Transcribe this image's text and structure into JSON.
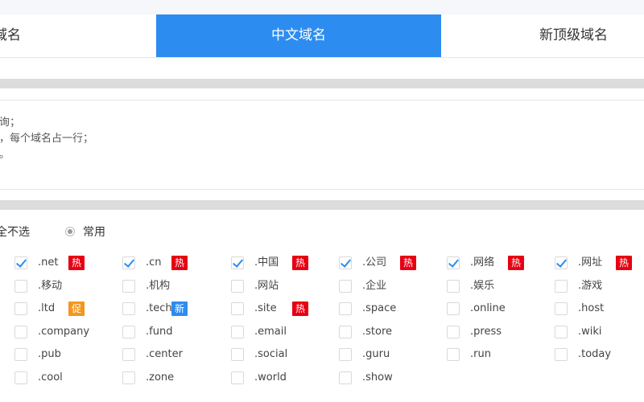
{
  "tabs": [
    {
      "label": "文域名"
    },
    {
      "label": "中文域名"
    },
    {
      "label": "新顶级域名"
    }
  ],
  "hints": [
    "查询；",
    "隔，每个域名占一行；",
    "缀。"
  ],
  "options": {
    "select_none": "全不选",
    "common": "常用"
  },
  "badges": {
    "hot": "热",
    "promo": "促",
    "new": "新"
  },
  "colors": {
    "accent": "#2d8cf0",
    "hot": "#e60012",
    "promo": "#f5961e",
    "new": "#2d8cf0"
  },
  "domains": [
    [
      {
        "label": ".net",
        "checked": true,
        "badge": "hot"
      },
      {
        "label": ".cn",
        "checked": true,
        "badge": "hot"
      },
      {
        "label": ".中国",
        "checked": true,
        "badge": "hot"
      },
      {
        "label": ".公司",
        "checked": true,
        "badge": "hot"
      },
      {
        "label": ".网络",
        "checked": true,
        "badge": "hot"
      },
      {
        "label": ".网址",
        "checked": true,
        "badge": "hot"
      }
    ],
    [
      {
        "label": ".移动",
        "checked": false,
        "badge": null
      },
      {
        "label": ".机构",
        "checked": false,
        "badge": null
      },
      {
        "label": ".网站",
        "checked": false,
        "badge": null
      },
      {
        "label": ".企业",
        "checked": false,
        "badge": null
      },
      {
        "label": ".娱乐",
        "checked": false,
        "badge": null
      },
      {
        "label": ".游戏",
        "checked": false,
        "badge": null
      }
    ],
    [
      {
        "label": ".ltd",
        "checked": false,
        "badge": "promo"
      },
      {
        "label": ".tech",
        "checked": false,
        "badge": "new"
      },
      {
        "label": ".site",
        "checked": false,
        "badge": "hot"
      },
      {
        "label": ".space",
        "checked": false,
        "badge": null
      },
      {
        "label": ".online",
        "checked": false,
        "badge": null
      },
      {
        "label": ".host",
        "checked": false,
        "badge": null
      }
    ],
    [
      {
        "label": ".company",
        "checked": false,
        "badge": null
      },
      {
        "label": ".fund",
        "checked": false,
        "badge": null
      },
      {
        "label": ".email",
        "checked": false,
        "badge": null
      },
      {
        "label": ".store",
        "checked": false,
        "badge": null
      },
      {
        "label": ".press",
        "checked": false,
        "badge": null
      },
      {
        "label": ".wiki",
        "checked": false,
        "badge": null
      }
    ],
    [
      {
        "label": ".pub",
        "checked": false,
        "badge": null
      },
      {
        "label": ".center",
        "checked": false,
        "badge": null
      },
      {
        "label": ".social",
        "checked": false,
        "badge": null
      },
      {
        "label": ".guru",
        "checked": false,
        "badge": null
      },
      {
        "label": ".run",
        "checked": false,
        "badge": null
      },
      {
        "label": ".today",
        "checked": false,
        "badge": null
      }
    ],
    [
      {
        "label": ".cool",
        "checked": false,
        "badge": null
      },
      {
        "label": ".zone",
        "checked": false,
        "badge": null
      },
      {
        "label": ".world",
        "checked": false,
        "badge": null
      },
      {
        "label": ".show",
        "checked": false,
        "badge": null
      }
    ]
  ]
}
